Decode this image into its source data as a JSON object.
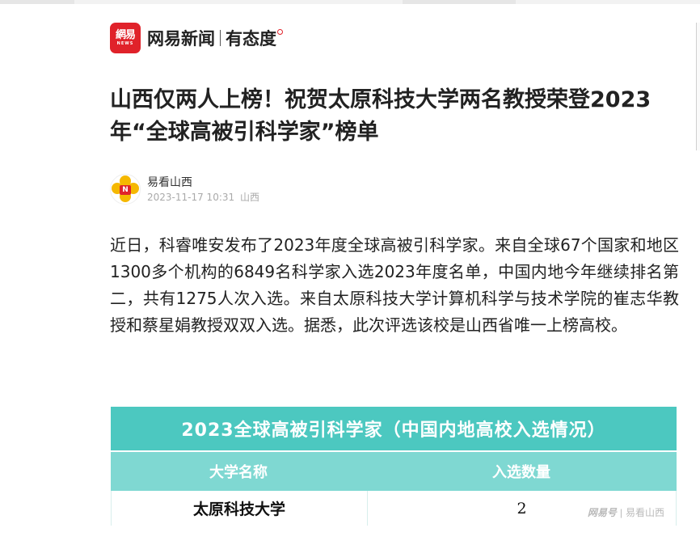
{
  "header": {
    "logo_text": "網易",
    "logo_sub": "NEWS",
    "brand_name": "网易新闻",
    "slogan": "有态度"
  },
  "article": {
    "title": "山西仅两人上榜！祝贺太原科技大学两名教授荣登2023年“全球高被引科学家”榜单",
    "author": "易看山西",
    "date": "2023-11-17 10:31",
    "location": "山西",
    "body": "近日，科睿唯安发布了2023年度全球高被引科学家。来自全球67个国家和地区1300多个机构的6849名科学家入选2023年度名单，中国内地今年继续排名第二，共有1275人次入选。来自太原科技大学计算机科学与技术学院的崔志华教授和蔡星娟教授双双入选。据悉，此次评选该校是山西省唯一上榜高校。"
  },
  "avatar_text": "N",
  "table": {
    "title": "2023全球高被引科学家（中国内地高校入选情况）",
    "headers": [
      "大学名称",
      "入选数量"
    ],
    "rows": [
      {
        "university": "太原科技大学",
        "count": "2"
      }
    ],
    "watermark_brand": "网易号",
    "watermark_author": "易看山西"
  },
  "colors": {
    "brand_red": "#e0222a",
    "table_title_bg": "#4cc8c0",
    "table_head_bg": "#7fd8d2"
  }
}
